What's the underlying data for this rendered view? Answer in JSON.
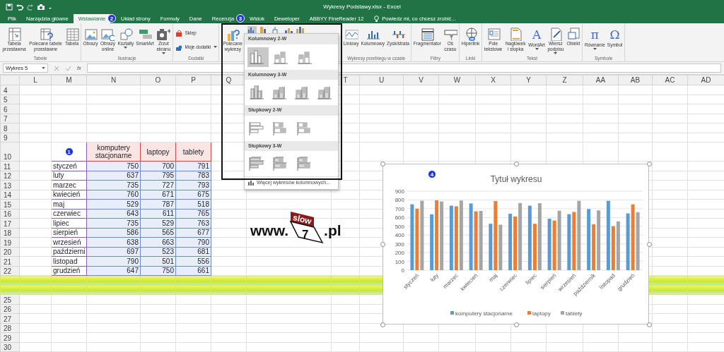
{
  "title_bar": {
    "title": "Wykresy Podstawy.xlsx - Excel"
  },
  "tabs": [
    {
      "label": "Plik",
      "selected": false
    },
    {
      "label": "Narzędzia główne",
      "selected": false
    },
    {
      "label": "Wstawianie",
      "selected": true,
      "badge": "2"
    },
    {
      "label": "Układ strony",
      "selected": false
    },
    {
      "label": "Formuły",
      "selected": false
    },
    {
      "label": "Dane",
      "selected": false
    },
    {
      "label": "Recenzja",
      "selected": false,
      "badge": "3"
    },
    {
      "label": "Widok",
      "selected": false
    },
    {
      "label": "Deweloper",
      "selected": false
    },
    {
      "label": "ABBYY FineReader 12",
      "selected": false
    }
  ],
  "tell_me": "Powiedz mi, co chcesz zrobić...",
  "ribbon_groups": [
    {
      "label": "Tabele",
      "kind": "large",
      "buttons": [
        {
          "label": "Tabela przestawna",
          "kind": "pivot-table",
          "has_menu": false
        },
        {
          "label": "Polecane tabele przestawne",
          "kind": "table-question",
          "has_menu": false
        },
        {
          "label": "Tabela",
          "kind": "table-grid",
          "has_menu": false
        }
      ]
    },
    {
      "label": "Ilustracje",
      "kind": "large",
      "buttons": [
        {
          "label": "Obrazy",
          "kind": "picture",
          "has_menu": false
        },
        {
          "label": "Obrazy online",
          "kind": "picture-globe",
          "has_menu": false
        },
        {
          "label": "Kształty",
          "kind": "shapes",
          "has_menu": true
        },
        {
          "label": "SmartArt",
          "kind": "smartart",
          "has_menu": false
        },
        {
          "label": "Zrzut ekranu",
          "kind": "camera",
          "has_menu": true
        }
      ]
    },
    {
      "label": "Dodatki",
      "kind": "stack",
      "buttons": [
        {
          "label": "Sklep",
          "kind": "bag",
          "has_menu": false
        },
        {
          "label": "Moje dodatki",
          "kind": "puzzle",
          "has_menu": true
        }
      ]
    },
    {
      "kind": "charts",
      "buttons": [
        {
          "label": "Polecane wykresy",
          "kind": "chart-question",
          "has_menu": false
        }
      ],
      "small_buttons": [
        {
          "kind": "column",
          "selected": true
        },
        {
          "kind": "bar",
          "selected": false
        },
        {
          "kind": "hierarchy",
          "selected": false
        },
        {
          "kind": "combo",
          "selected": false
        },
        {
          "kind": "pivot-chart",
          "selected": false
        }
      ]
    },
    {
      "label": "Wykresy przebiegu w czasie",
      "kind": "large",
      "buttons": [
        {
          "label": "Liniowy",
          "kind": "sparkline-line",
          "has_menu": false
        },
        {
          "label": "Kolumnowy",
          "kind": "sparkline-column",
          "has_menu": false
        },
        {
          "label": "Zysk/strata",
          "kind": "sparkline-winloss",
          "has_menu": false
        }
      ]
    },
    {
      "label": "Filtry",
      "kind": "large",
      "buttons": [
        {
          "label": "Fragmentator",
          "kind": "slicer",
          "has_menu": false
        },
        {
          "label": "Oś czasu",
          "kind": "timeline",
          "has_menu": false
        }
      ]
    },
    {
      "label": "Linki",
      "kind": "large",
      "buttons": [
        {
          "label": "Hiperlink",
          "kind": "globe-link",
          "has_menu": false
        }
      ]
    },
    {
      "label": "Tekst",
      "kind": "large",
      "buttons": [
        {
          "label": "Pole tekstowe",
          "kind": "textbox",
          "has_menu": false
        },
        {
          "label": "Nagłówek i stopka",
          "kind": "page",
          "has_menu": false
        },
        {
          "label": "WordArt",
          "kind": "glyph",
          "glyph": "A",
          "has_menu": true
        },
        {
          "label": "Wiersz podpisu",
          "kind": "signature",
          "has_menu": true
        },
        {
          "label": "Obiekt",
          "kind": "object",
          "has_menu": false
        }
      ]
    },
    {
      "label": "Symbole",
      "kind": "large",
      "buttons": [
        {
          "label": "Równanie",
          "kind": "glyph",
          "glyph": "π",
          "has_menu": true
        },
        {
          "label": "Symbol",
          "kind": "glyph",
          "glyph": "Ω",
          "has_menu": false
        }
      ]
    }
  ],
  "formula_bar": {
    "name_box": "Wykres 5",
    "function_label": "fx"
  },
  "chart_menu": {
    "sections": [
      {
        "title": "Kolumnowy 2-W",
        "kind": "column2d",
        "options": [
          {
            "kind": "clustered",
            "selected": true
          },
          {
            "kind": "stacked",
            "selected": false
          },
          {
            "kind": "percent",
            "selected": false
          }
        ]
      },
      {
        "title": "Kolumnowy 3-W",
        "kind": "column3d",
        "options": [
          {
            "kind": "clustered",
            "selected": false
          },
          {
            "kind": "stacked",
            "selected": false
          },
          {
            "kind": "percent",
            "selected": false
          },
          {
            "kind": "deep",
            "selected": false
          }
        ]
      },
      {
        "title": "Słupkowy 2-W",
        "kind": "bar2d",
        "options": [
          {
            "kind": "clustered",
            "selected": false
          },
          {
            "kind": "stacked",
            "selected": false
          },
          {
            "kind": "percent",
            "selected": false
          }
        ]
      },
      {
        "title": "Słupkowy 3-W",
        "kind": "bar3d",
        "options": [
          {
            "kind": "clustered",
            "selected": false
          },
          {
            "kind": "stacked",
            "selected": false
          },
          {
            "kind": "percent",
            "selected": false
          }
        ]
      }
    ],
    "more_link": "Więcej wykresów kolumnowych..."
  },
  "sheet": {
    "columns": [
      "L",
      "M",
      "N",
      "O",
      "P",
      "Q",
      "T",
      "U",
      "V",
      "W",
      "X",
      "Y",
      "Z",
      "AA",
      "AB",
      "AC",
      "AD"
    ],
    "rows": [
      {
        "kind": "blank",
        "number": "4"
      },
      {
        "kind": "blank",
        "number": "5"
      },
      {
        "kind": "blank",
        "number": "6"
      },
      {
        "kind": "blank",
        "number": "7"
      },
      {
        "kind": "blank",
        "number": "8"
      },
      {
        "kind": "blank",
        "number": "9"
      },
      {
        "kind": "header",
        "number": "10",
        "badge": "1",
        "headers": [
          "komputery stacjonarne",
          "laptopy",
          "tablety"
        ]
      },
      {
        "kind": "data",
        "number": "11",
        "label": "styczeń",
        "values": [
          "750",
          "700",
          "791"
        ]
      },
      {
        "kind": "data",
        "number": "12",
        "label": "luty",
        "values": [
          "637",
          "795",
          "783"
        ]
      },
      {
        "kind": "data",
        "number": "13",
        "label": "marzec",
        "values": [
          "735",
          "727",
          "793"
        ]
      },
      {
        "kind": "data",
        "number": "14",
        "label": "kwiecień",
        "values": [
          "760",
          "671",
          "675"
        ]
      },
      {
        "kind": "data",
        "number": "15",
        "label": "maj",
        "values": [
          "529",
          "787",
          "518"
        ]
      },
      {
        "kind": "data",
        "number": "16",
        "label": "czerwiec",
        "values": [
          "643",
          "611",
          "765"
        ]
      },
      {
        "kind": "data",
        "number": "17",
        "label": "lipiec",
        "values": [
          "735",
          "529",
          "763"
        ]
      },
      {
        "kind": "data",
        "number": "18",
        "label": "sierpień",
        "values": [
          "586",
          "565",
          "677"
        ]
      },
      {
        "kind": "data",
        "number": "19",
        "label": "wrzesień",
        "values": [
          "638",
          "663",
          "790"
        ]
      },
      {
        "kind": "data",
        "number": "20",
        "label": "październi",
        "values": [
          "697",
          "523",
          "681"
        ]
      },
      {
        "kind": "data",
        "number": "21",
        "label": "listopad",
        "values": [
          "790",
          "501",
          "556"
        ]
      },
      {
        "kind": "data",
        "number": "22",
        "label": "grudzień",
        "values": [
          "647",
          "750",
          "661"
        ]
      },
      {
        "kind": "glitch"
      },
      {
        "kind": "glitch"
      },
      {
        "kind": "blank",
        "number": "25"
      },
      {
        "kind": "blank",
        "number": "26"
      },
      {
        "kind": "blank",
        "number": "27"
      },
      {
        "kind": "blank",
        "number": "28"
      },
      {
        "kind": "blank",
        "number": "29"
      },
      {
        "kind": "blank",
        "number": "30"
      }
    ]
  },
  "logo": {
    "prefix": "www.",
    "mark_top": "slow",
    "mark_number": "7",
    "suffix": ".pl"
  },
  "chart": {
    "badge": "4",
    "chart_data": {
      "type": "bar",
      "title": "Tytuł wykresu",
      "categories": [
        "styczeń",
        "luty",
        "marzec",
        "kwiecień",
        "maj",
        "czerwiec",
        "lipiec",
        "sierpień",
        "wrzesień",
        "październik",
        "listopad",
        "grudzień"
      ],
      "series": [
        {
          "name": "komputery stacjonarne",
          "color": "#5b9bd5",
          "values": [
            750,
            637,
            735,
            760,
            529,
            643,
            735,
            586,
            638,
            697,
            790,
            647
          ]
        },
        {
          "name": "laptopy",
          "color": "#ed7d31",
          "values": [
            700,
            795,
            727,
            671,
            787,
            611,
            529,
            565,
            663,
            523,
            501,
            750
          ]
        },
        {
          "name": "tablety",
          "color": "#a5a5a5",
          "values": [
            791,
            783,
            793,
            675,
            518,
            765,
            763,
            677,
            790,
            681,
            556,
            661
          ]
        }
      ],
      "ylim": [
        0,
        900
      ],
      "yticks": [
        0,
        100,
        200,
        300,
        400,
        500,
        600,
        700,
        800,
        900
      ],
      "grid": true,
      "legend": true
    }
  }
}
